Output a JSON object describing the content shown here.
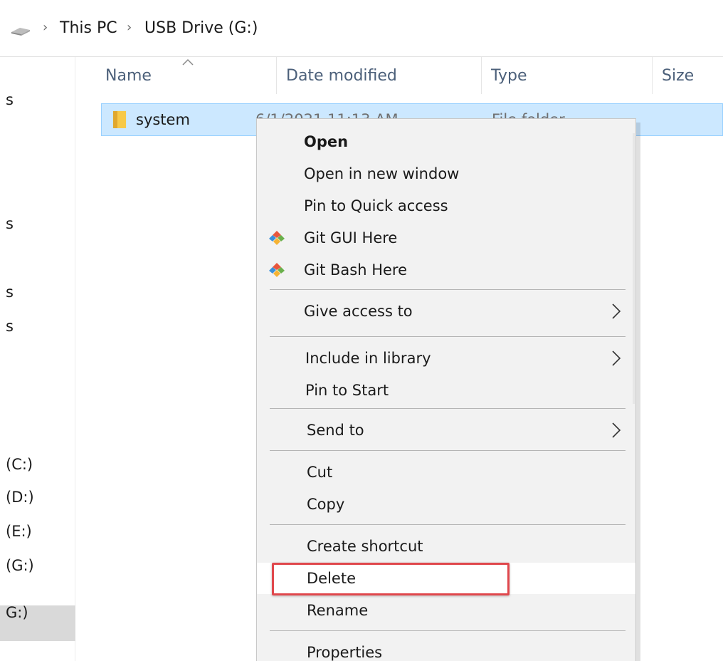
{
  "addressbar": {
    "drive_icon": "usb-drive-icon",
    "separator": "›",
    "crumbs": [
      "This PC",
      "USB Drive (G:)"
    ]
  },
  "sidebar": {
    "items": [
      "s",
      "s",
      "s",
      "s",
      "(C:)",
      "(D:)",
      "(E:)",
      "(G:)",
      "G:)"
    ],
    "selected_index": 7
  },
  "columns": {
    "name": "Name",
    "date": "Date modified",
    "type": "Type",
    "size": "Size",
    "sort_icon": "sort-ascending-icon"
  },
  "files": [
    {
      "name": "system",
      "date": "6/1/2021 11:13 AM",
      "type": "File folder",
      "icon": "folder-icon"
    }
  ],
  "context_menu": {
    "items": [
      {
        "label": "Open",
        "bold": true
      },
      {
        "label": "Open in new window"
      },
      {
        "label": "Pin to Quick access"
      },
      {
        "label": "Git GUI Here",
        "icon": "git-icon"
      },
      {
        "label": "Git Bash Here",
        "icon": "git-icon"
      },
      {
        "label": "Give access to",
        "submenu": true
      },
      {
        "label": "Include in library",
        "submenu": true
      },
      {
        "label": "Pin to Start"
      },
      {
        "label": "Send to",
        "submenu": true
      },
      {
        "label": "Cut"
      },
      {
        "label": "Copy"
      },
      {
        "label": "Create shortcut"
      },
      {
        "label": "Delete",
        "hovered": true,
        "highlighted": true
      },
      {
        "label": "Rename"
      },
      {
        "label": "Properties"
      }
    ],
    "highlight_color": "#e0474c"
  },
  "colors": {
    "selection_bg": "#cce8ff",
    "selection_border": "#99d1ff",
    "header_text": "#4c607a",
    "menu_bg": "#f2f2f2"
  }
}
